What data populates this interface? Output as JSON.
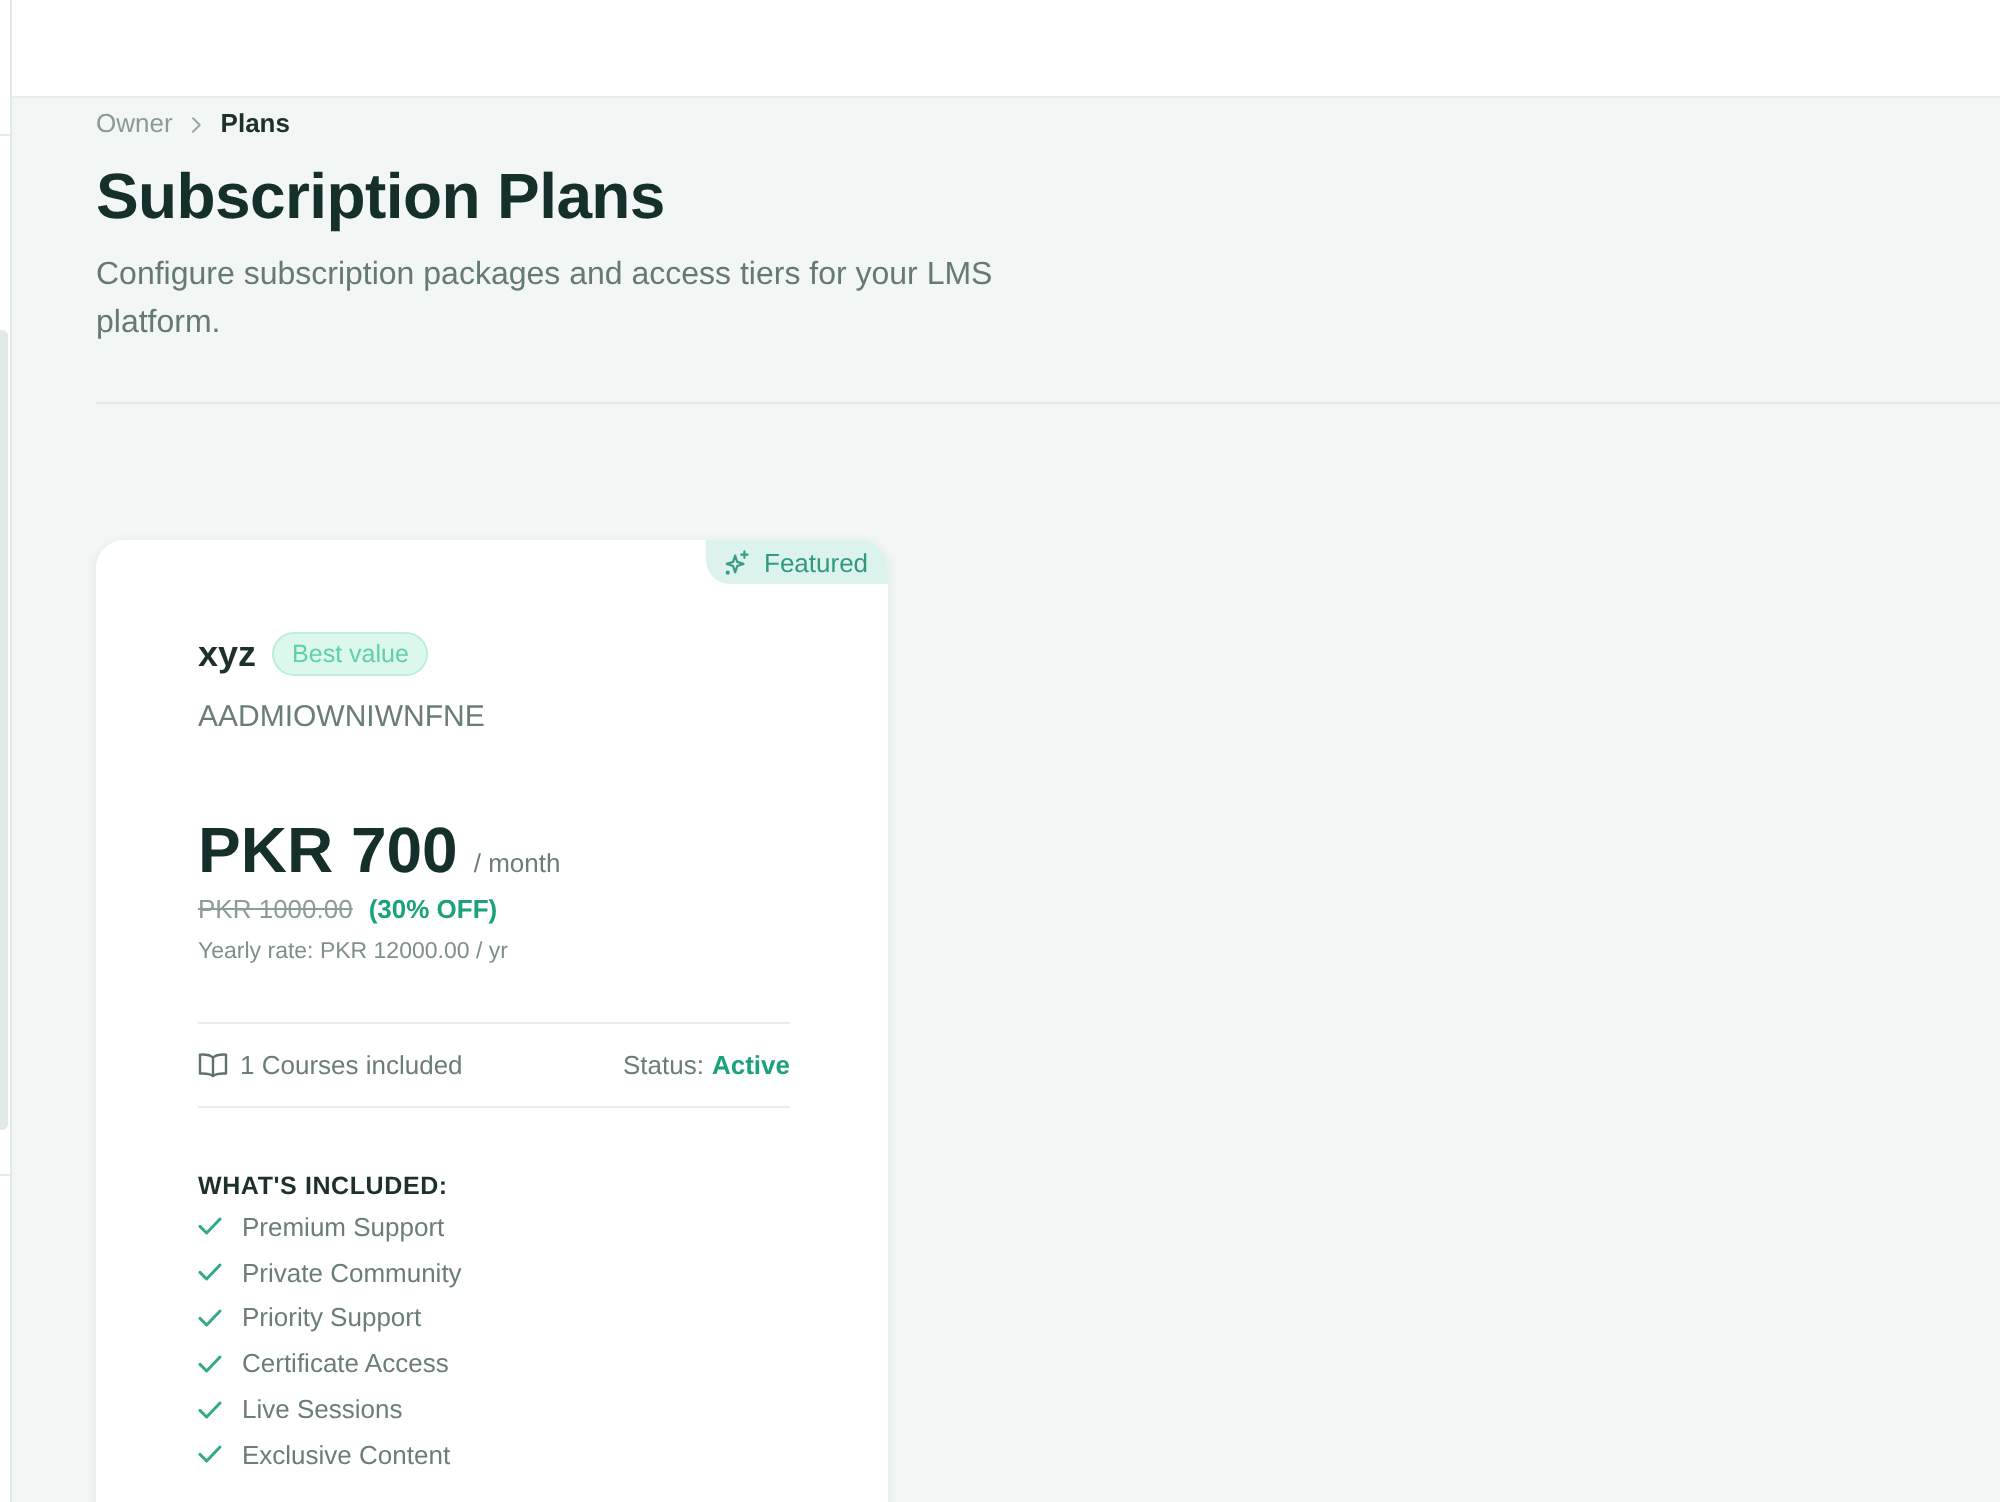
{
  "breadcrumb": [
    {
      "label": "Owner",
      "current": false
    },
    {
      "label": "Plans",
      "current": true
    }
  ],
  "page": {
    "title": "Subscription Plans",
    "subtitle": "Configure subscription packages and access tiers for your LMS platform."
  },
  "plans": [
    {
      "featured": true,
      "featured_label": "Featured",
      "name": "xyz",
      "tag": "Best value",
      "code": "AADMIOWNIWNFNE",
      "price": "PKR 700",
      "period": "/ month",
      "original_price": "PKR 1000.00",
      "discount": "(30% OFF)",
      "yearly_rate": "Yearly rate: PKR 12000.00 / yr",
      "courses": "1 Courses included",
      "status_label": "Status:",
      "status": "Active",
      "features_title": "WHAT'S INCLUDED:",
      "features": [
        "Premium Support",
        "Private Community",
        "Priority Support",
        "Certificate Access",
        "Live Sessions",
        "Exclusive Content"
      ]
    }
  ]
}
